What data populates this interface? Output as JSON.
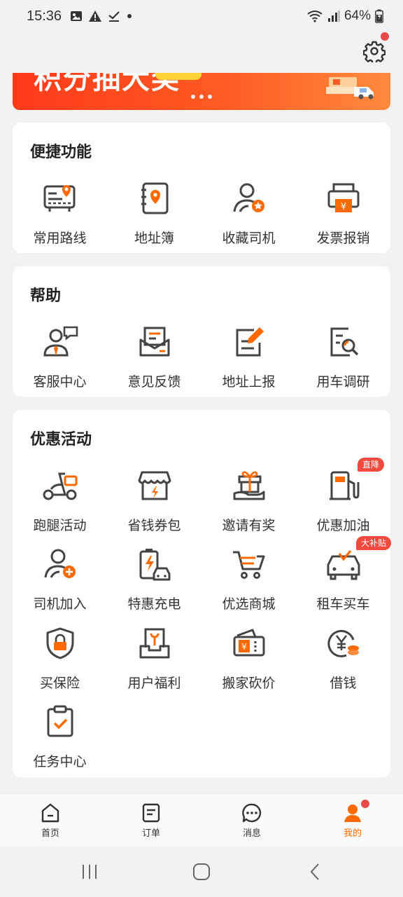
{
  "status_bar": {
    "time": "15:36",
    "battery": "64%"
  },
  "banner": {
    "headline": "积分抽大奖"
  },
  "sections": {
    "quick": {
      "title": "便捷功能",
      "items": [
        {
          "label": "常用路线",
          "icon": "route-map-icon"
        },
        {
          "label": "地址簿",
          "icon": "address-book-icon"
        },
        {
          "label": "收藏司机",
          "icon": "favorite-driver-icon"
        },
        {
          "label": "发票报销",
          "icon": "invoice-printer-icon"
        }
      ]
    },
    "help": {
      "title": "帮助",
      "items": [
        {
          "label": "客服中心",
          "icon": "customer-service-icon"
        },
        {
          "label": "意见反馈",
          "icon": "feedback-mail-icon"
        },
        {
          "label": "地址上报",
          "icon": "address-report-icon"
        },
        {
          "label": "用车调研",
          "icon": "survey-search-icon"
        }
      ]
    },
    "promo": {
      "title": "优惠活动",
      "items": [
        {
          "label": "跑腿活动",
          "icon": "scooter-icon"
        },
        {
          "label": "省钱券包",
          "icon": "store-coupon-icon"
        },
        {
          "label": "邀请有奖",
          "icon": "gift-invite-icon"
        },
        {
          "label": "优惠加油",
          "icon": "fuel-pump-icon",
          "badge": "直降"
        },
        {
          "label": "司机加入",
          "icon": "driver-join-icon"
        },
        {
          "label": "特惠充电",
          "icon": "ev-charging-icon"
        },
        {
          "label": "优选商城",
          "icon": "shopping-cart-icon"
        },
        {
          "label": "租车买车",
          "icon": "car-rental-icon",
          "badge": "大补贴"
        },
        {
          "label": "买保险",
          "icon": "insurance-shield-icon"
        },
        {
          "label": "用户福利",
          "icon": "user-benefit-icon"
        },
        {
          "label": "搬家砍价",
          "icon": "moving-wallet-icon"
        },
        {
          "label": "借钱",
          "icon": "loan-coin-icon"
        },
        {
          "label": "任务中心",
          "icon": "task-clipboard-icon"
        }
      ]
    }
  },
  "tabs": [
    {
      "label": "首页",
      "icon": "home-icon"
    },
    {
      "label": "订单",
      "icon": "order-icon"
    },
    {
      "label": "消息",
      "icon": "message-icon"
    },
    {
      "label": "我的",
      "icon": "profile-icon",
      "active": true
    }
  ],
  "colors": {
    "accent": "#ff6a00",
    "icon_gray": "#444444",
    "badge_red": "#f04a3e"
  }
}
